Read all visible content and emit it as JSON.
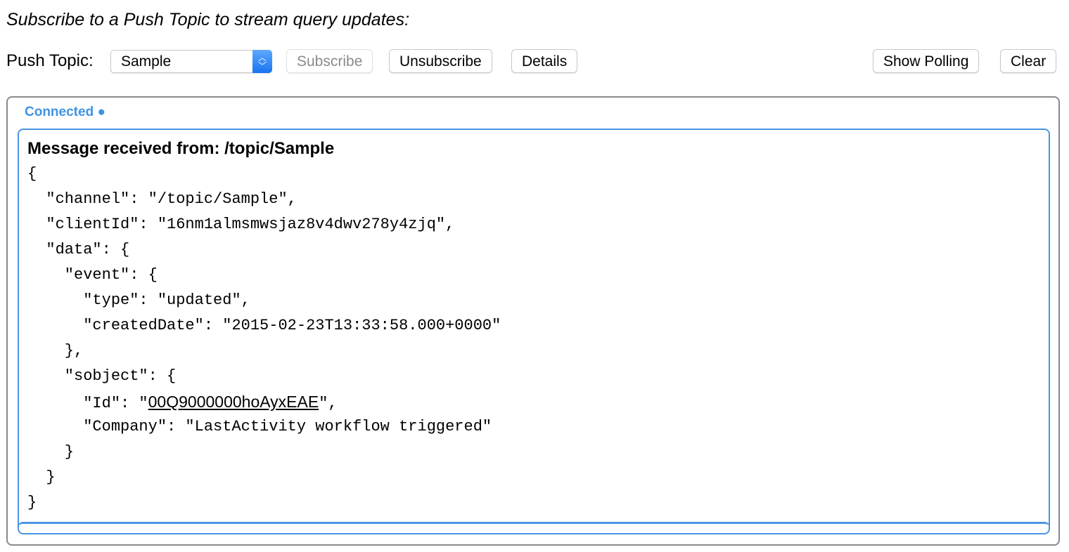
{
  "intro": "Subscribe to a Push Topic to stream query updates:",
  "toolbar": {
    "push_topic_label": "Push Topic:",
    "push_topic_value": "Sample",
    "subscribe": "Subscribe",
    "unsubscribe": "Unsubscribe",
    "details": "Details",
    "show_polling": "Show Polling",
    "clear": "Clear"
  },
  "status": "Connected ●",
  "message": {
    "title": "Message received from: /topic/Sample",
    "lines": [
      "{",
      "  \"channel\": \"/topic/Sample\",",
      "  \"clientId\": \"16nm1almsmwsjaz8v4dwv278y4zjq\",",
      "  \"data\": {",
      "    \"event\": {",
      "      \"type\": \"updated\",",
      "      \"createdDate\": \"2015-02-23T13:33:58.000+0000\"",
      "    },",
      "    \"sobject\": {",
      "      \"Id\": \"",
      "      \"Company\": \"LastActivity workflow triggered\"",
      "    }",
      "  }",
      "}"
    ],
    "id_link": "00Q9000000hoAyxEAE",
    "id_suffix": "\","
  }
}
